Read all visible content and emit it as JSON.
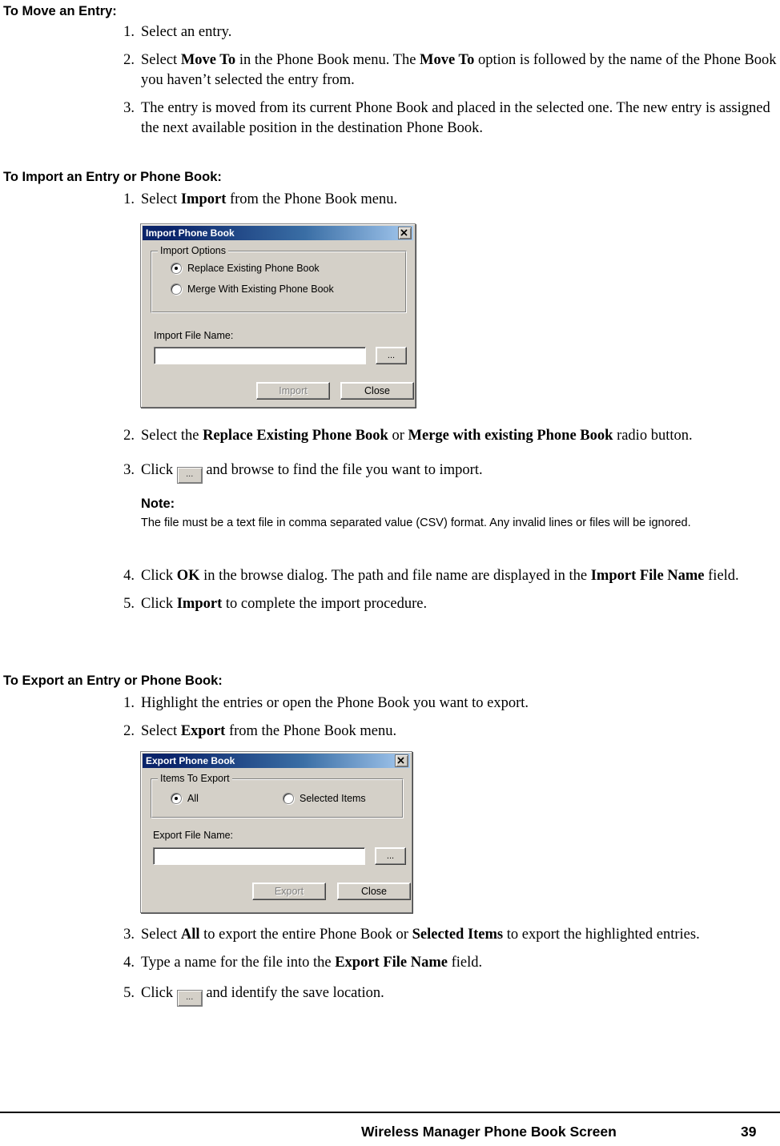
{
  "sections": {
    "move": {
      "heading": "To Move an Entry:",
      "steps": [
        {
          "num": "1.",
          "html": "Select an entry."
        },
        {
          "num": "2.",
          "html": "Select <b>Move To</b> in the Phone Book menu. The <b>Move To</b> option is followed by the name of the Phone Book you haven’t selected the entry from."
        },
        {
          "num": "3.",
          "html": "The entry is moved from its current Phone Book and placed in the selected one. The new entry is assigned the next available position in the destination Phone Book."
        }
      ]
    },
    "import": {
      "heading": "To Import an Entry or Phone Book:",
      "step1": {
        "num": "1.",
        "html": "Select <b>Import</b> from the Phone Book menu."
      },
      "step2": {
        "num": "2.",
        "html": "Select the <b>Replace Existing Phone Book</b> or <b>Merge with existing Phone Book</b> radio button."
      },
      "step3": {
        "num": "3.",
        "pre": "Click ",
        "dots": "...",
        "post": " and browse to find the file you want to import."
      },
      "note": {
        "title": "Note:",
        "body": "The file must be a text file in comma separated value (CSV) format. Any invalid lines or files will be ignored."
      },
      "step4": {
        "num": "4.",
        "html": "Click <b>OK</b> in the browse dialog. The path and file name are displayed in the <b>Import File Name</b> field."
      },
      "step5": {
        "num": "5.",
        "html": "Click <b>Import</b> to complete the import procedure."
      }
    },
    "export": {
      "heading": "To Export an Entry or Phone Book:",
      "step1": {
        "num": "1.",
        "html": "Highlight the entries or open the Phone Book you want to export."
      },
      "step2": {
        "num": "2.",
        "html": "Select <b>Export</b> from the Phone Book menu."
      },
      "step3": {
        "num": "3.",
        "html": "Select <b>All</b> to export the entire Phone Book or <b>Selected Items</b> to export the highlighted entries."
      },
      "step4": {
        "num": "4.",
        "html": "Type a name for the file into the <b>Export File Name</b> field."
      },
      "step5": {
        "num": "5.",
        "pre": "Click ",
        "dots": "...",
        "post": " and identify the save location."
      }
    }
  },
  "import_dialog": {
    "title": "Import Phone Book",
    "close_label": "×",
    "group_label": "Import Options",
    "radio_replace": "Replace Existing Phone Book",
    "radio_merge": "Merge With Existing Phone Book",
    "file_label": "Import File Name:",
    "file_value": "",
    "browse_label": "...",
    "ok_label": "Import",
    "cancel_label": "Close"
  },
  "export_dialog": {
    "title": "Export Phone Book",
    "close_label": "×",
    "group_label": "Items To Export",
    "radio_all": "All",
    "radio_selected": "Selected Items",
    "file_label": "Export File Name:",
    "file_value": "",
    "browse_label": "...",
    "ok_label": "Export",
    "cancel_label": "Close"
  },
  "footer": {
    "title": "Wireless Manager Phone Book Screen",
    "page_number": "39"
  }
}
